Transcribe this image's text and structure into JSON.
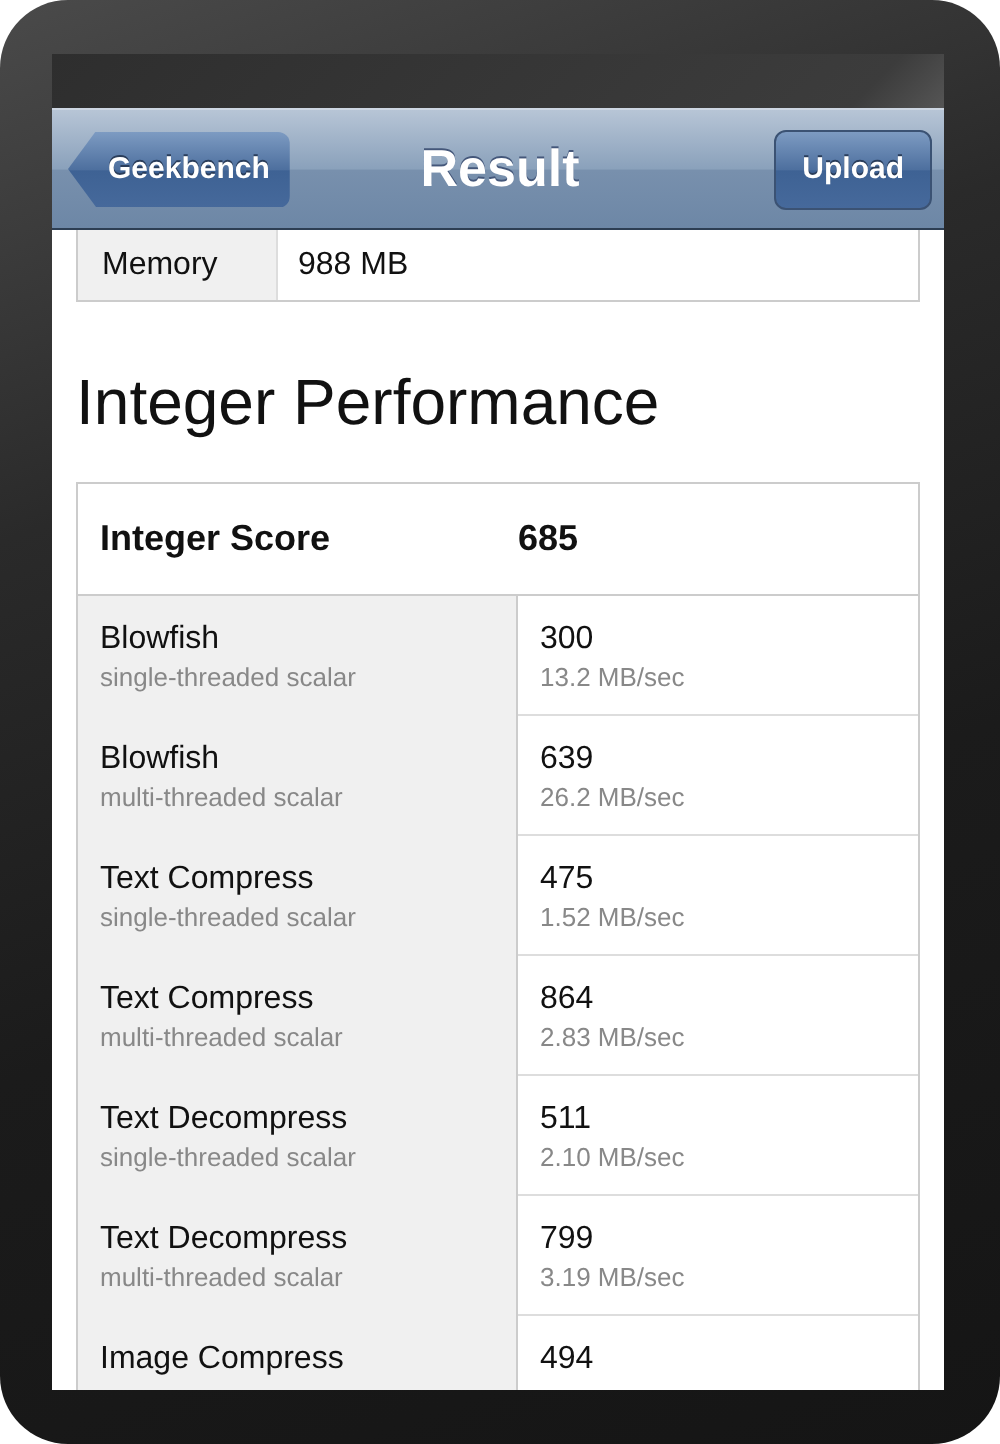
{
  "nav_bar": {
    "back_button": "Geekbench",
    "title": "Result",
    "action_button": "Upload"
  },
  "system_info": [
    {
      "label": "Memory",
      "value": "988 MB"
    }
  ],
  "section": {
    "title": "Integer Performance",
    "table": {
      "header": {
        "label": "Integer Score",
        "score": "685"
      },
      "rows": [
        {
          "name": "Blowfish",
          "mode": "single-threaded scalar",
          "score": "300",
          "rate": "13.2 MB/sec"
        },
        {
          "name": "Blowfish",
          "mode": "multi-threaded scalar",
          "score": "639",
          "rate": "26.2 MB/sec"
        },
        {
          "name": "Text Compress",
          "mode": "single-threaded scalar",
          "score": "475",
          "rate": "1.52 MB/sec"
        },
        {
          "name": "Text Compress",
          "mode": "multi-threaded scalar",
          "score": "864",
          "rate": "2.83 MB/sec"
        },
        {
          "name": "Text Decompress",
          "mode": "single-threaded scalar",
          "score": "511",
          "rate": "2.10 MB/sec"
        },
        {
          "name": "Text Decompress",
          "mode": "multi-threaded scalar",
          "score": "799",
          "rate": "3.19 MB/sec"
        },
        {
          "name": "Image Compress",
          "score": "494"
        }
      ]
    }
  }
}
